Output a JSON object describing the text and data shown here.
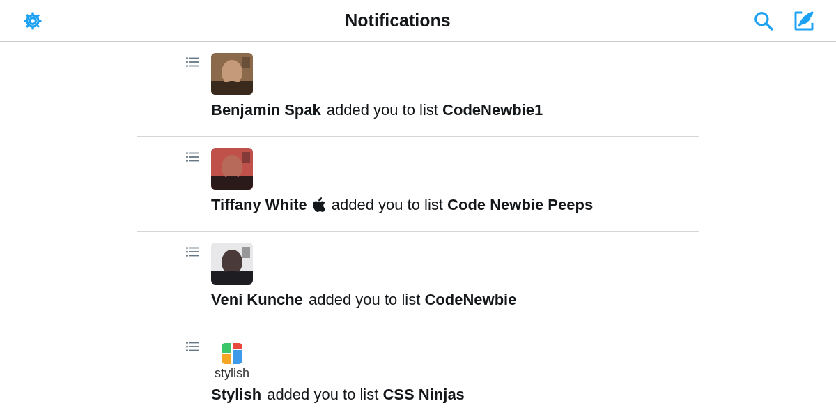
{
  "header": {
    "title": "Notifications"
  },
  "notifications": [
    {
      "actor": "Benjamin Spak",
      "action": "added you to list **CodeNewbie1**"
    },
    {
      "actor": "Tiffany White",
      "apple_badge": true,
      "action": "added you to list **Code Newbie Peeps**"
    },
    {
      "actor": "Veni Kunche",
      "action": "added you to list **CodeNewbie**"
    },
    {
      "avatar": {
        "kind": "logo",
        "logo_text": "stylish"
      },
      "actor": "Stylish",
      "action": "added you to list **CSS Ninjas**"
    }
  ]
}
